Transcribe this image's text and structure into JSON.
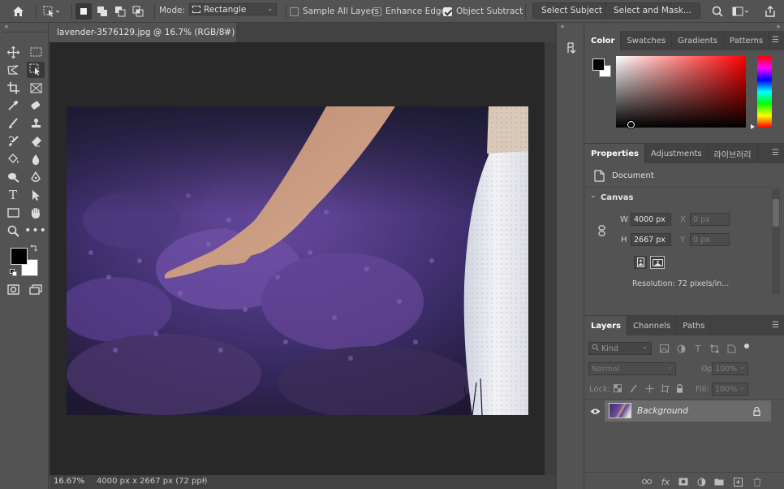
{
  "options_bar": {
    "mode_label": "Mode:",
    "mode_value": "Rectangle",
    "sample_all_layers": {
      "label": "Sample All Layers",
      "checked": false
    },
    "enhance_edge": {
      "label": "Enhance Edge",
      "checked": false
    },
    "object_subtract": {
      "label": "Object Subtract",
      "checked": true
    },
    "select_subject": "Select Subject",
    "select_and_mask": "Select and Mask..."
  },
  "document": {
    "tab_title": "lavender-3576129.jpg @ 16.7% (RGB/8#)",
    "close_glyph": "×",
    "zoom": "16.67%",
    "info": "4000 px x 2667 px (72 ppi)",
    "info_arrow": "›"
  },
  "color_panel": {
    "tabs": [
      "Color",
      "Swatches",
      "Gradients",
      "Patterns"
    ],
    "active_tab": "Color",
    "hue": "#ff0000"
  },
  "properties_panel": {
    "tabs": [
      "Properties",
      "Adjustments",
      "라이브러리"
    ],
    "document_label": "Document",
    "section": "Canvas",
    "width_label": "W",
    "width_value": "4000 px",
    "height_label": "H",
    "height_value": "2667 px",
    "x_label": "X",
    "x_placeholder": "0 px",
    "y_label": "Y",
    "y_placeholder": "0 px",
    "resolution": "Resolution: 72 pixels/in..."
  },
  "layers_panel": {
    "tabs": [
      "Layers",
      "Channels",
      "Paths"
    ],
    "filter_kind": "Kind",
    "blend_mode": "Normal",
    "opacity_label": "Opacity:",
    "opacity_value": "100%",
    "lock_label": "Lock:",
    "fill_label": "Fill:",
    "fill_value": "100%",
    "layers": [
      {
        "name": "Background",
        "visible": true,
        "locked": true
      }
    ]
  },
  "colors": {
    "foreground": "#000000",
    "background": "#ffffff",
    "accent": "#1473e6"
  }
}
